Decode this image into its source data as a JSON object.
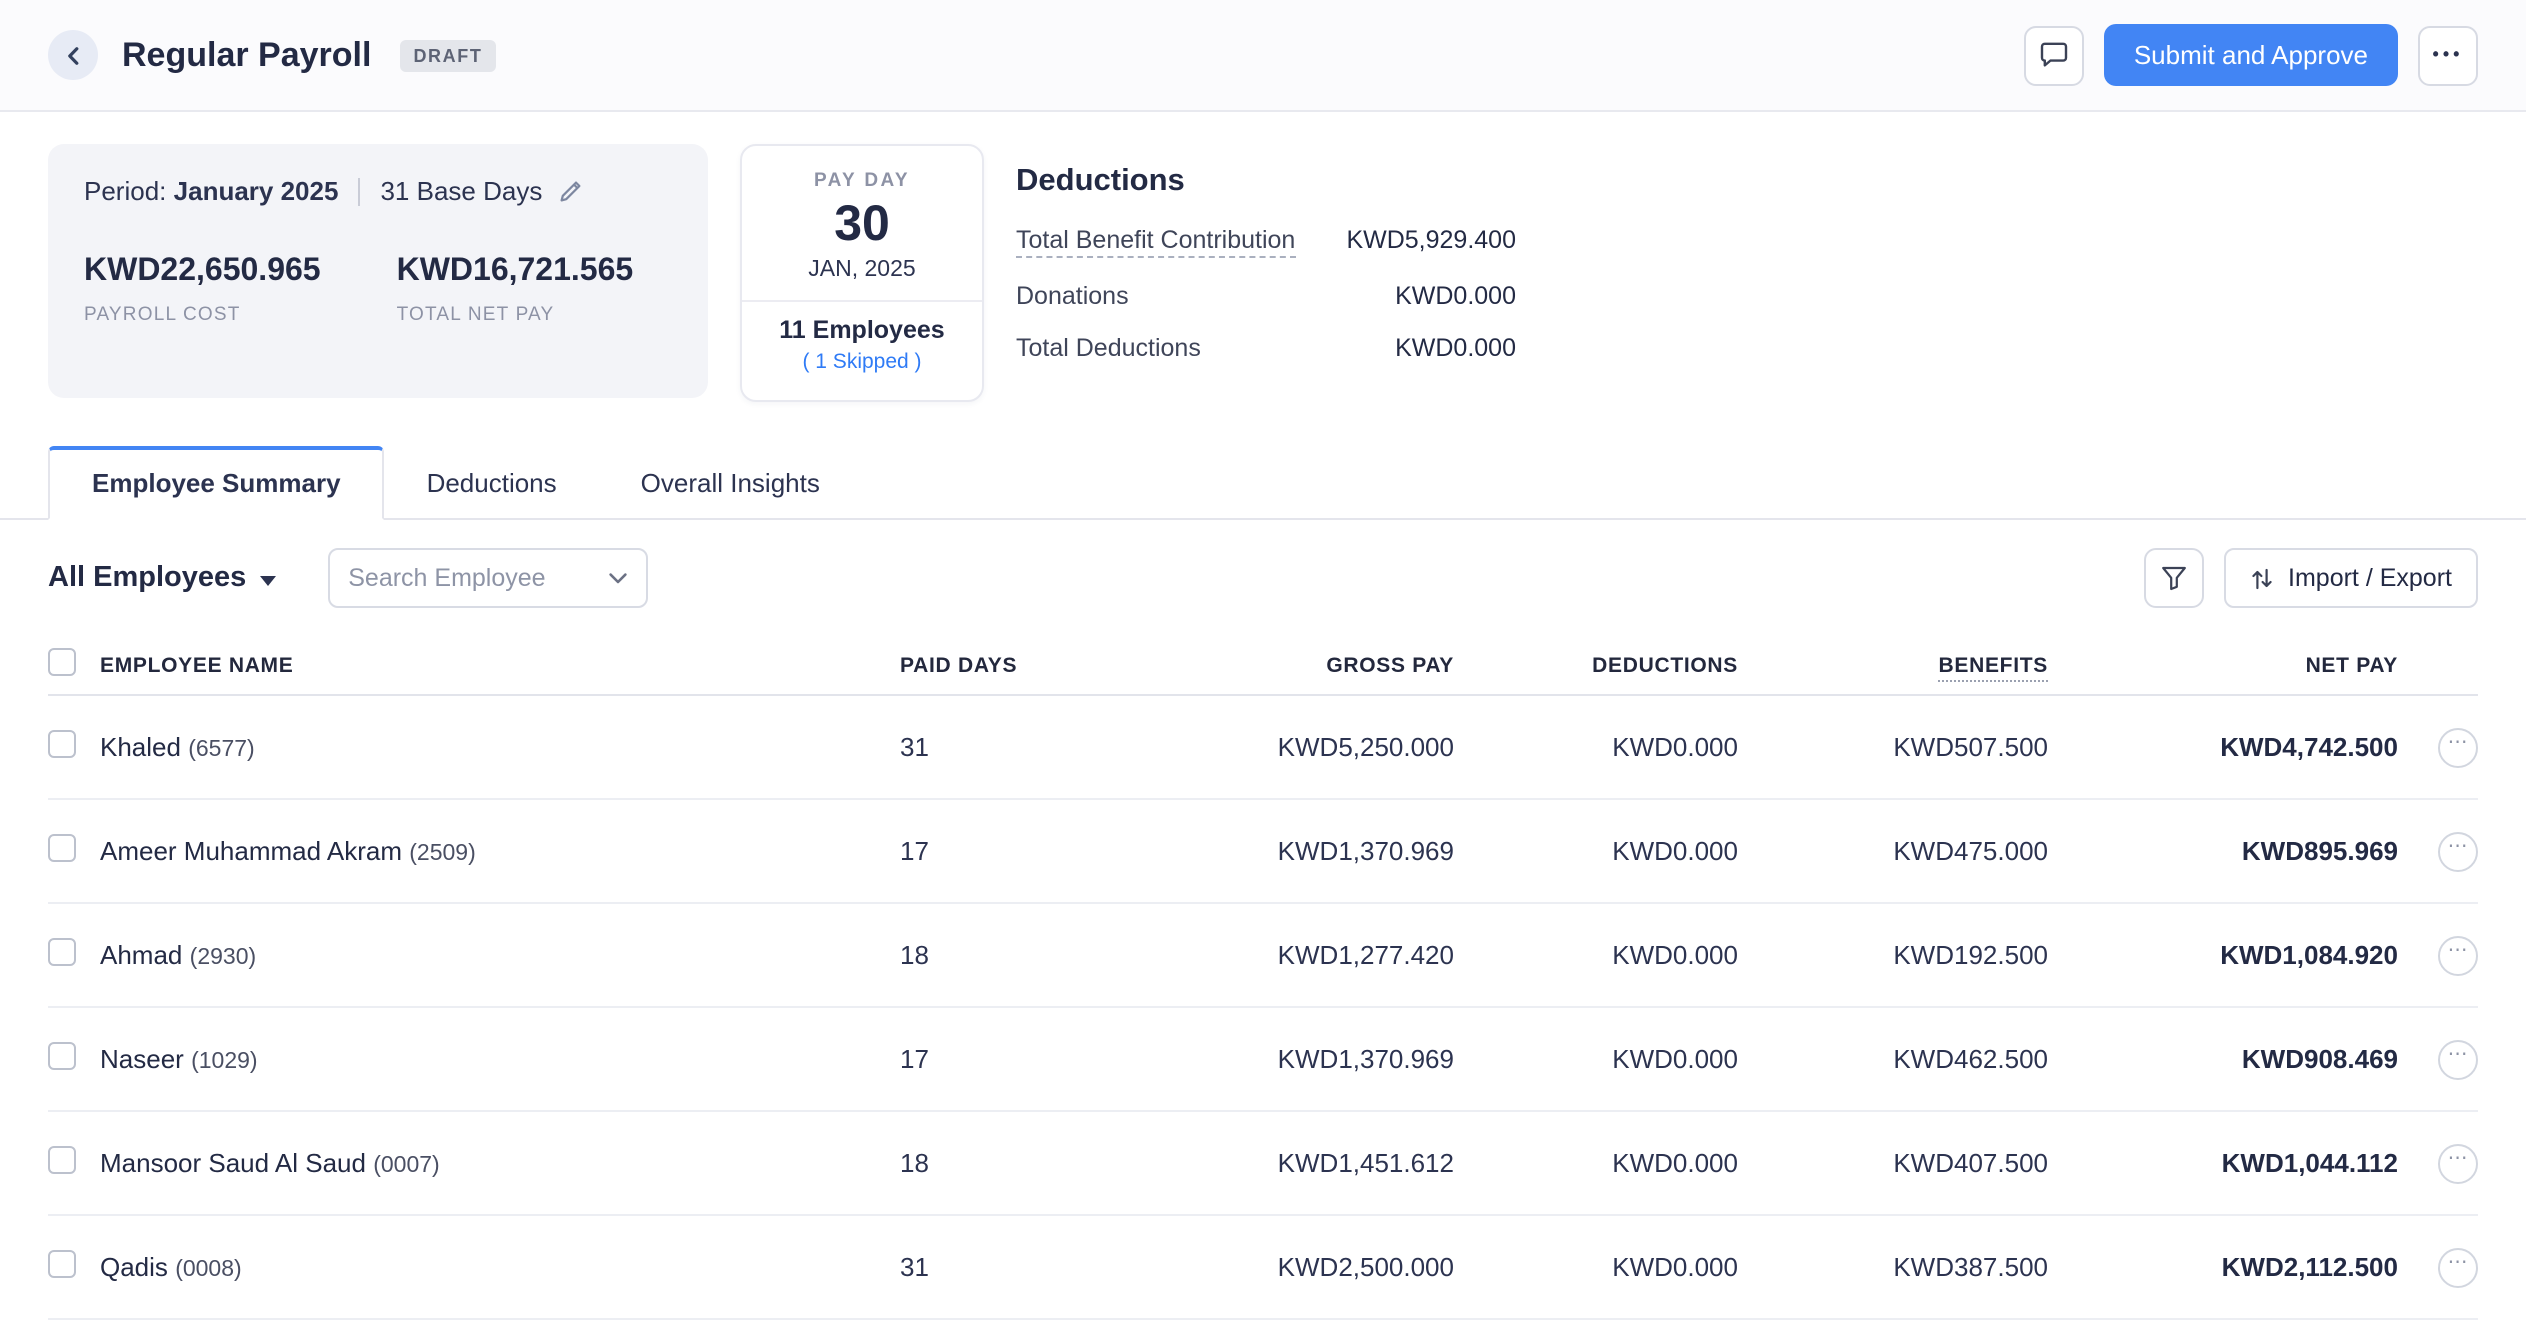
{
  "header": {
    "title": "Regular Payroll",
    "status_badge": "DRAFT",
    "submit_button": "Submit and Approve"
  },
  "summary": {
    "period": {
      "label": "Period:",
      "value": "January 2025",
      "base_days": "31 Base Days",
      "payroll_cost": {
        "value": "KWD22,650.965",
        "label": "PAYROLL COST"
      },
      "net_pay": {
        "value": "KWD16,721.565",
        "label": "TOTAL NET PAY"
      }
    },
    "payday": {
      "label": "PAY DAY",
      "day": "30",
      "date": "JAN, 2025",
      "employees": "11 Employees",
      "skipped": "( 1 Skipped )"
    },
    "deductions": {
      "title": "Deductions",
      "rows": [
        {
          "label": "Total Benefit Contribution",
          "value": "KWD5,929.400"
        },
        {
          "label": "Donations",
          "value": "KWD0.000"
        },
        {
          "label": "Total Deductions",
          "value": "KWD0.000"
        }
      ]
    }
  },
  "tabs": [
    {
      "label": "Employee Summary",
      "active": true
    },
    {
      "label": "Deductions",
      "active": false
    },
    {
      "label": "Overall Insights",
      "active": false
    }
  ],
  "toolbar": {
    "employee_filter": "All Employees",
    "search_placeholder": "Search Employee",
    "import_export": "Import / Export"
  },
  "table": {
    "headers": {
      "name": "EMPLOYEE NAME",
      "paid_days": "PAID DAYS",
      "gross_pay": "GROSS PAY",
      "deductions": "DEDUCTIONS",
      "benefits": "BENEFITS",
      "net_pay": "NET PAY"
    },
    "rows": [
      {
        "name": "Khaled",
        "id": "(6577)",
        "paid_days": "31",
        "gross_pay": "KWD5,250.000",
        "deductions": "KWD0.000",
        "benefits": "KWD507.500",
        "net_pay": "KWD4,742.500"
      },
      {
        "name": "Ameer Muhammad Akram",
        "id": "(2509)",
        "paid_days": "17",
        "gross_pay": "KWD1,370.969",
        "deductions": "KWD0.000",
        "benefits": "KWD475.000",
        "net_pay": "KWD895.969"
      },
      {
        "name": "Ahmad",
        "id": "(2930)",
        "paid_days": "18",
        "gross_pay": "KWD1,277.420",
        "deductions": "KWD0.000",
        "benefits": "KWD192.500",
        "net_pay": "KWD1,084.920"
      },
      {
        "name": "Naseer",
        "id": "(1029)",
        "paid_days": "17",
        "gross_pay": "KWD1,370.969",
        "deductions": "KWD0.000",
        "benefits": "KWD462.500",
        "net_pay": "KWD908.469"
      },
      {
        "name": "Mansoor Saud Al Saud",
        "id": "(0007)",
        "paid_days": "18",
        "gross_pay": "KWD1,451.612",
        "deductions": "KWD0.000",
        "benefits": "KWD407.500",
        "net_pay": "KWD1,044.112"
      },
      {
        "name": "Qadis",
        "id": "(0008)",
        "paid_days": "31",
        "gross_pay": "KWD2,500.000",
        "deductions": "KWD0.000",
        "benefits": "KWD387.500",
        "net_pay": "KWD2,112.500"
      }
    ]
  },
  "colors": {
    "accent": "#4285f4",
    "skipped_link": "#2f7bf6"
  }
}
